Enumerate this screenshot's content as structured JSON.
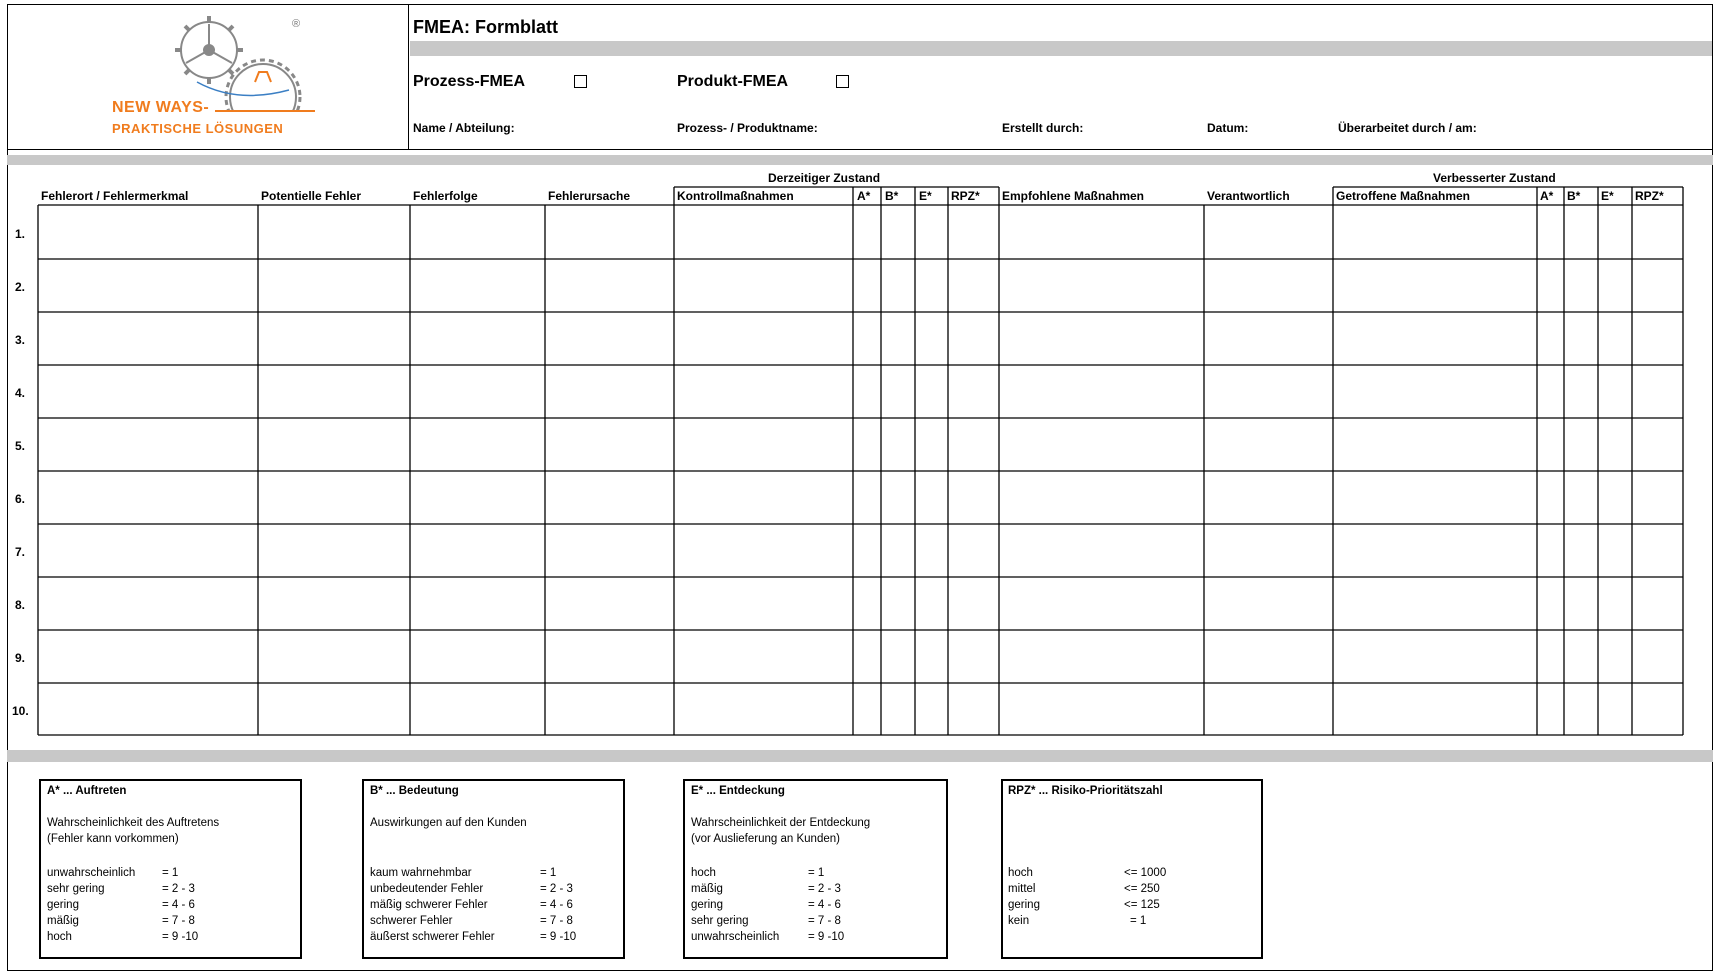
{
  "logo": {
    "line1": "NEW WAYS-",
    "line2": "PRAKTISCHE LÖSUNGEN",
    "registered": "®",
    "brand_color": "#f07c1e"
  },
  "header": {
    "title": "FMEA: Formblatt",
    "options": [
      {
        "label": "Prozess-FMEA",
        "checked": false
      },
      {
        "label": "Produkt-FMEA",
        "checked": false
      }
    ],
    "fields": [
      "Name / Abteilung:",
      "Prozess- / Produktname:",
      "Erstellt durch:",
      "Datum:",
      "Überarbeitet durch / am:"
    ]
  },
  "table": {
    "groups": [
      "Derzeitiger Zustand",
      "Verbesserter Zustand"
    ],
    "columns": [
      "Fehlerort / Fehlermerkmal",
      "Potentielle Fehler",
      "Fehlerfolge",
      "Fehlerursache",
      "Kontrollmaßnahmen",
      "A*",
      "B*",
      "E*",
      "RPZ*",
      "Empfohlene Maßnahmen",
      "Verantwortlich",
      "Getroffene Maßnahmen",
      "A*",
      "B*",
      "E*",
      "RPZ*"
    ],
    "rows": [
      "1.",
      "2.",
      "3.",
      "4.",
      "5.",
      "6.",
      "7.",
      "8.",
      "9.",
      "10."
    ]
  },
  "legend": [
    {
      "title": "A* ... Auftreten",
      "description": [
        "Wahrscheinlichkeit des Auftretens",
        "(Fehler kann vorkommen)"
      ],
      "scale": [
        [
          "unwahrscheinlich",
          "= 1"
        ],
        [
          "sehr gering",
          "= 2 - 3"
        ],
        [
          "gering",
          "= 4 - 6"
        ],
        [
          "mäßig",
          "= 7 - 8"
        ],
        [
          "hoch",
          "= 9 -10"
        ]
      ]
    },
    {
      "title": "B* ... Bedeutung",
      "description": [
        "Auswirkungen auf den Kunden",
        ""
      ],
      "scale": [
        [
          "kaum wahrnehmbar",
          "= 1"
        ],
        [
          "unbedeutender Fehler",
          "= 2 - 3"
        ],
        [
          "mäßig schwerer Fehler",
          "= 4 - 6"
        ],
        [
          "schwerer Fehler",
          "= 7 - 8"
        ],
        [
          "äußerst schwerer Fehler",
          "= 9 -10"
        ]
      ]
    },
    {
      "title": "E* ... Entdeckung",
      "description": [
        "Wahrscheinlichkeit der Entdeckung",
        "(vor Auslieferung an Kunden)"
      ],
      "scale": [
        [
          "hoch",
          "= 1"
        ],
        [
          "mäßig",
          "= 2 - 3"
        ],
        [
          "gering",
          "= 4 - 6"
        ],
        [
          "sehr gering",
          "= 7 - 8"
        ],
        [
          "unwahrscheinlich",
          "= 9 -10"
        ]
      ]
    },
    {
      "title": "RPZ* ... Risiko-Prioritätszahl",
      "description": [
        "",
        ""
      ],
      "scale": [
        [
          "hoch",
          "<= 1000"
        ],
        [
          "mittel",
          "<= 250"
        ],
        [
          "gering",
          "<= 125"
        ],
        [
          "kein",
          "= 1"
        ]
      ]
    }
  ]
}
